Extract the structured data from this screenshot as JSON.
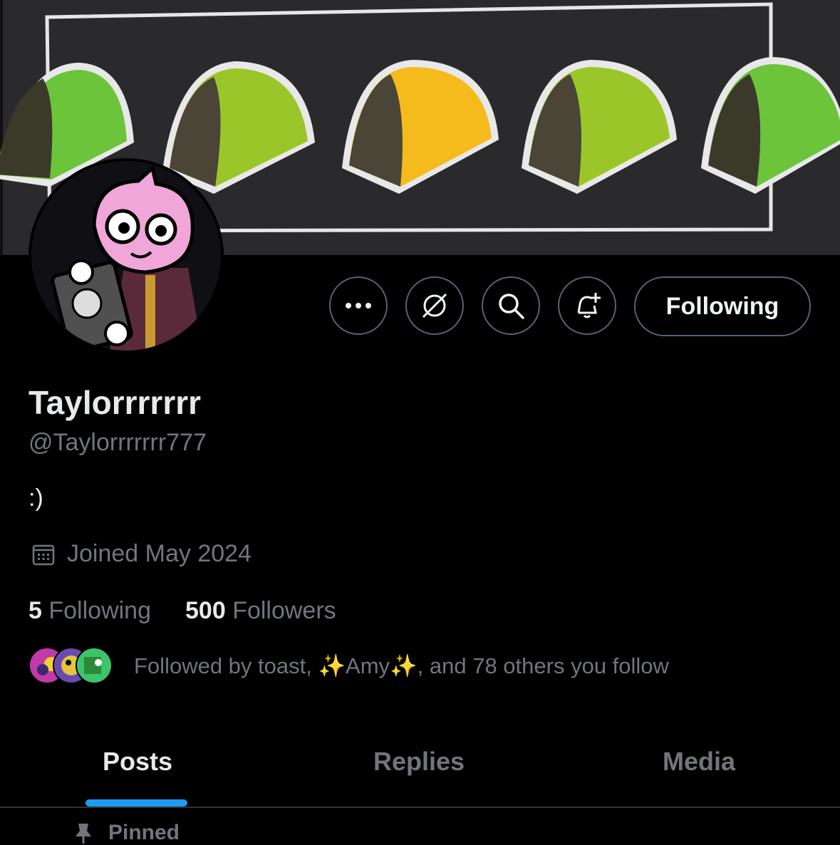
{
  "colors": {
    "background": "#000000",
    "accent": "#1d9bf0",
    "text_primary": "#e7e9ea",
    "text_secondary": "#71767b",
    "border": "#536471"
  },
  "profile": {
    "display_name": "Taylorrrrrrr",
    "handle": "@Taylorrrrrrr777",
    "bio": ":)",
    "joined": "Joined May 2024"
  },
  "actions": {
    "more_icon": "more-icon",
    "grok_icon": "grok-icon",
    "search_icon": "search-icon",
    "notify_icon": "bell-plus-icon",
    "follow_label": "Following"
  },
  "stats": {
    "following_count": "5",
    "following_label": "Following",
    "followers_count": "500",
    "followers_label": "Followers"
  },
  "followed_by": {
    "text": "Followed by toast, ✨Amy✨, and 78 others you follow"
  },
  "tabs": [
    {
      "label": "Posts",
      "active": true
    },
    {
      "label": "Replies",
      "active": false
    },
    {
      "label": "Media",
      "active": false
    }
  ],
  "pinned": {
    "label": "Pinned"
  }
}
